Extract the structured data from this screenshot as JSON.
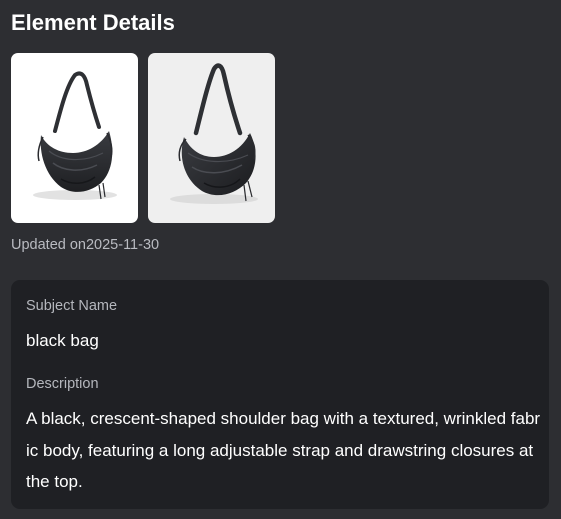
{
  "panel": {
    "title": "Element Details",
    "updated_label": "Updated on2025-11-30"
  },
  "images": [
    {
      "name": "bag-front-image",
      "background": "#ffffff"
    },
    {
      "name": "bag-angle-image",
      "background": "#efefef"
    }
  ],
  "details": {
    "subject_label": "Subject Name",
    "subject_value": "black bag",
    "description_label": "Description",
    "description_value": "A black, crescent-shaped shoulder bag with a textured, wrinkled fabric body, featuring a long adjustable strap and drawstring closures at the top."
  },
  "colors": {
    "background": "#2d2e32",
    "card": "#1f2024",
    "text_primary": "#ffffff",
    "text_secondary": "#b5b7bd",
    "bag": "#2b2d31"
  }
}
